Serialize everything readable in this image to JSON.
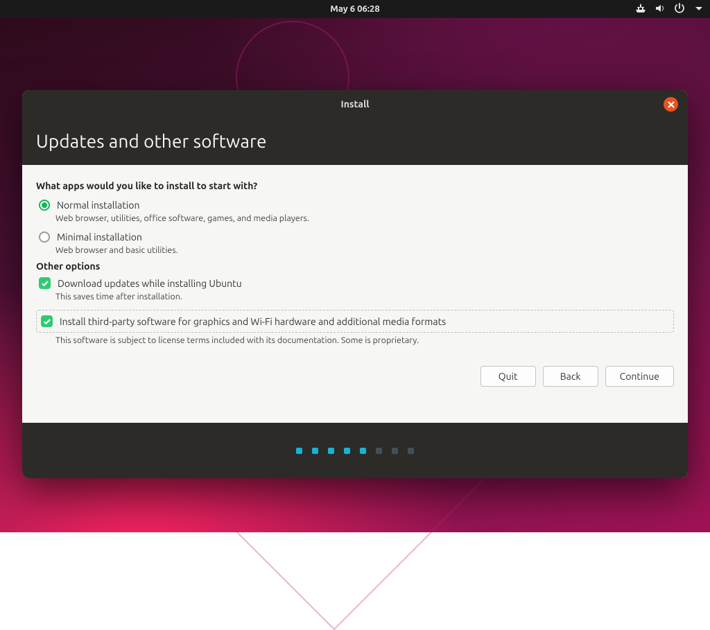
{
  "topbar": {
    "date_time": "May 6  06:28"
  },
  "window": {
    "title": "Install",
    "heading": "Updates and other software"
  },
  "form": {
    "question": "What apps would you like to install to start with?",
    "normal": {
      "label": "Normal installation",
      "desc": "Web browser, utilities, office software, games, and media players.",
      "selected": true
    },
    "minimal": {
      "label": "Minimal installation",
      "desc": "Web browser and basic utilities.",
      "selected": false
    },
    "other_title": "Other options",
    "download": {
      "label": "Download updates while installing Ubuntu",
      "desc": "This saves time after installation.",
      "checked": true
    },
    "thirdparty": {
      "label": "Install third-party software for graphics and Wi-Fi hardware and additional media formats",
      "desc": "This software is subject to license terms included with its documentation. Some is proprietary.",
      "checked": true
    }
  },
  "buttons": {
    "quit": "Quit",
    "back": "Back",
    "continue": "Continue"
  },
  "pager": {
    "total": 8,
    "current": 5
  }
}
